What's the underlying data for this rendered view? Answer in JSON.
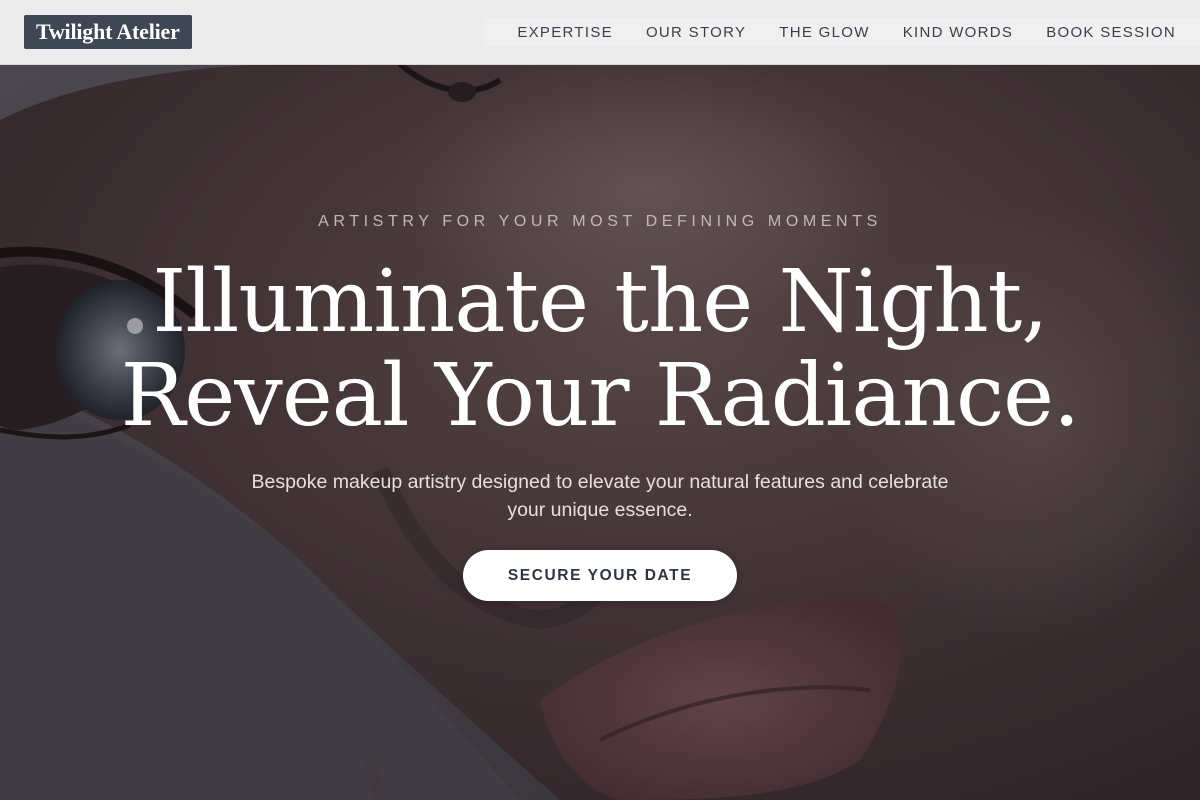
{
  "brand": {
    "logo_text": "Twilight Atelier"
  },
  "nav": {
    "items": [
      {
        "label": "EXPERTISE"
      },
      {
        "label": "OUR STORY"
      },
      {
        "label": "THE GLOW"
      },
      {
        "label": "KIND WORDS"
      },
      {
        "label": "BOOK SESSION"
      }
    ]
  },
  "hero": {
    "eyebrow": "ARTISTRY FOR YOUR MOST DEFINING MOMENTS",
    "headline_line1": "Illuminate the Night,",
    "headline_line2": "Reveal Your Radiance.",
    "subtitle": "Bespoke makeup artistry designed to elevate your natural features and celebrate your unique essence.",
    "cta_label": "SECURE YOUR DATE"
  },
  "colors": {
    "navbar_bg": "#ececed",
    "logo_bg": "#3f4654",
    "nav_text": "#3a3f4a",
    "hero_text": "#ffffff",
    "cta_bg": "#ffffff",
    "cta_text": "#2f3441"
  }
}
